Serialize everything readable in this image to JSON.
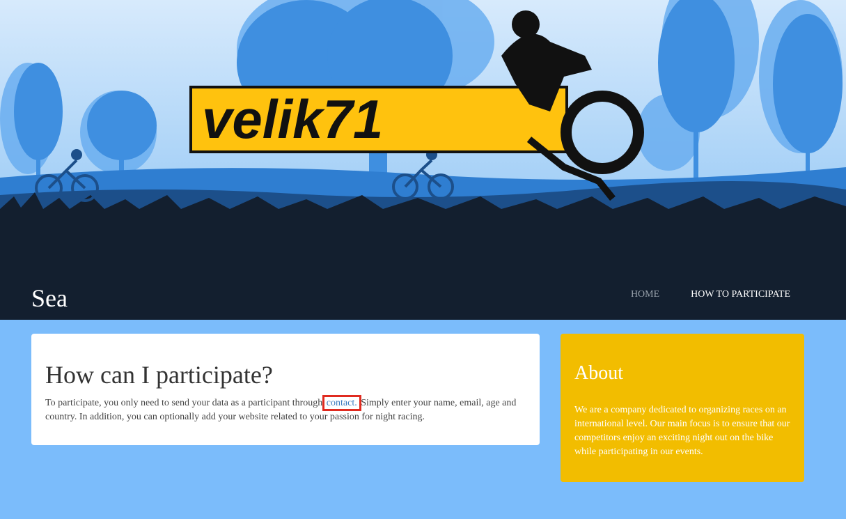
{
  "header": {
    "logo_text": "velik71",
    "site_title": "Sea",
    "nav": {
      "home": "HOME",
      "how_to_participate": "HOW TO PARTICIPATE"
    }
  },
  "main": {
    "heading": "How can I participate?",
    "text_before_link": "To participate, you only need to send your data as a participant through ",
    "link_text": "contact.",
    "text_after_link": " Simply enter your name, email, age and country. In addition, you can optionally add your website related to your passion for night racing."
  },
  "sidebar": {
    "heading": "About",
    "text": "We are a company dedicated to organizing races on an international level. Our main focus is to ensure that our competitors enjoy an exciting night out on the bike while participating in our events."
  },
  "colors": {
    "page_background": "#7bbcfb",
    "header_dark": "#131f2f",
    "about_card": "#f2bd00",
    "logo_yellow": "#ffc20e",
    "highlight_red": "#e02b20"
  },
  "icons": [
    "cyclist-silhouette",
    "mountain-bike-logo"
  ]
}
